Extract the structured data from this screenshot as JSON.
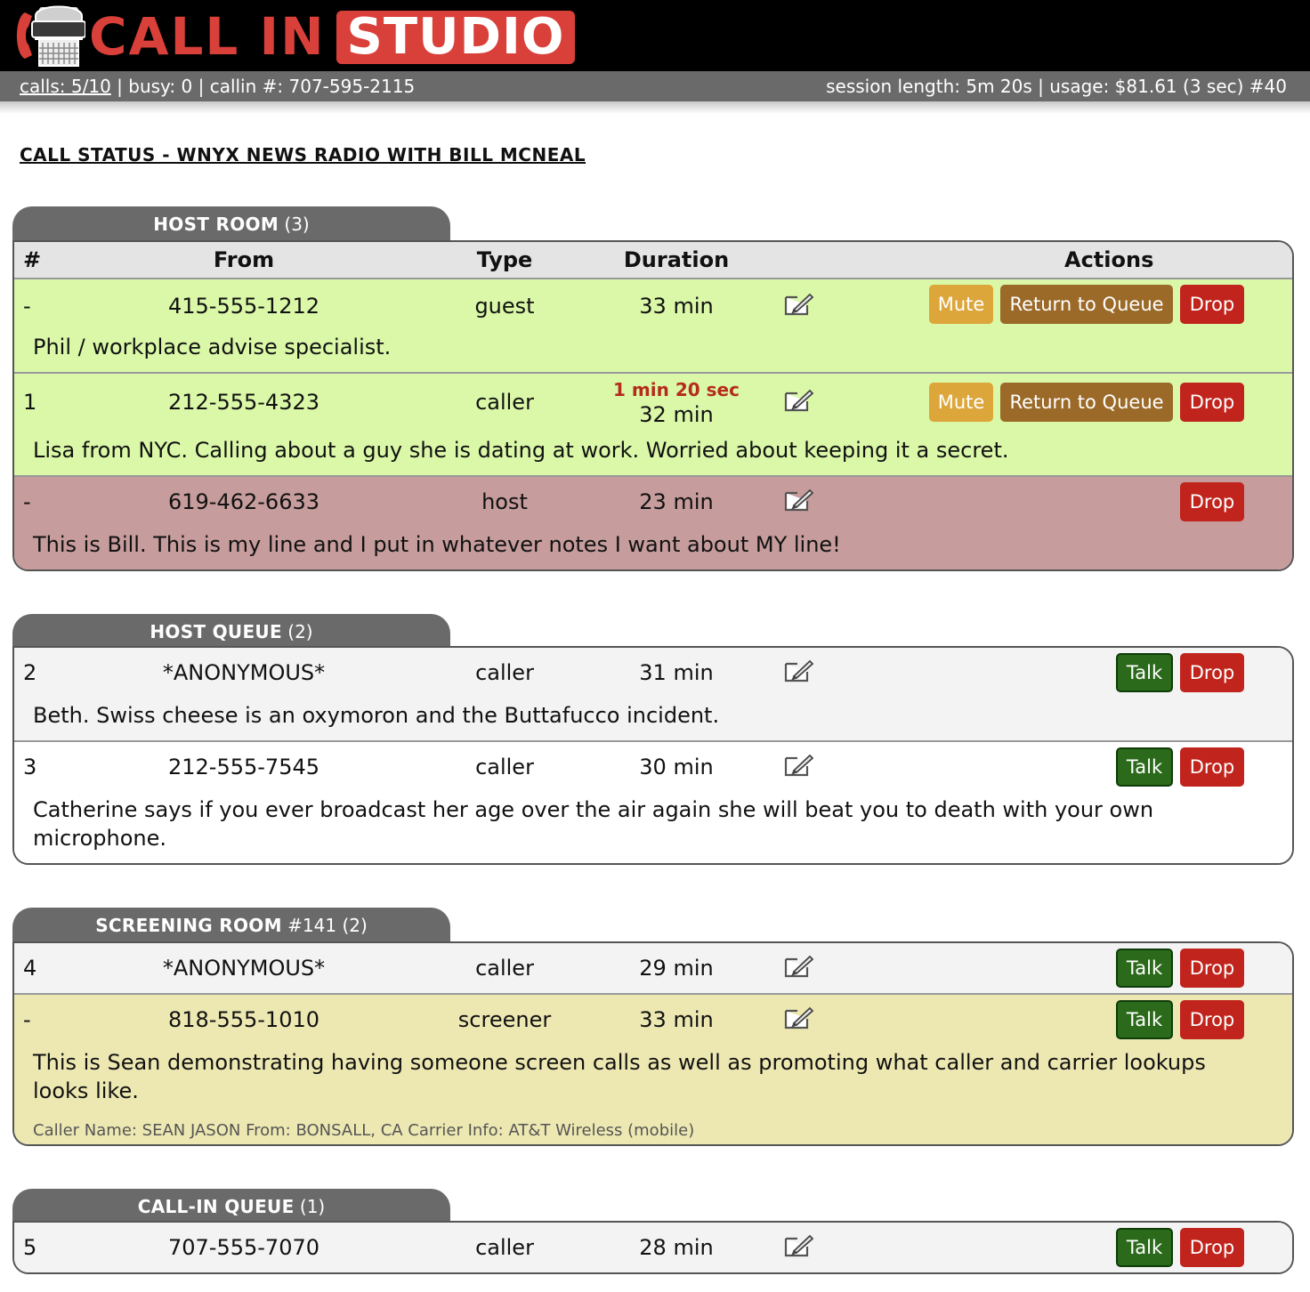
{
  "app": {
    "logo_call": "CALL IN",
    "logo_studio": "STUDIO"
  },
  "status": {
    "calls": "calls: 5/10",
    "rest_left": " | busy: 0 | callin #: 707-595-2115",
    "right": "session length: 5m 20s | usage: $81.61 (3 sec) #40"
  },
  "page_title": "CALL STATUS - WNYX NEWS RADIO WITH BILL MCNEAL",
  "columns": {
    "num": "#",
    "from": "From",
    "type": "Type",
    "duration": "Duration",
    "actions": "Actions"
  },
  "buttons": {
    "mute": "Mute",
    "return": "Return to Queue",
    "drop": "Drop",
    "talk": "Talk"
  },
  "host_room": {
    "title": "HOST ROOM",
    "count": "(3)",
    "rows": [
      {
        "num": "-",
        "from": "415-555-1212",
        "type": "guest",
        "duration": "33 min",
        "notes": "Phil / workplace advise specialist."
      },
      {
        "num": "1",
        "from": "212-555-4323",
        "type": "caller",
        "on_air": "1 min 20 sec",
        "duration": "32 min",
        "notes": "Lisa from NYC. Calling about a guy she is dating at work. Worried about keeping it a secret."
      },
      {
        "num": "-",
        "from": "619-462-6633",
        "type": "host",
        "duration": "23 min",
        "notes": "This is Bill. This is my line and I put in whatever notes I want about MY line!"
      }
    ]
  },
  "host_queue": {
    "title": "HOST QUEUE",
    "count": "(2)",
    "rows": [
      {
        "num": "2",
        "from": "*ANONYMOUS*",
        "type": "caller",
        "duration": "31 min",
        "notes": "Beth. Swiss cheese is an oxymoron and the Buttafucco incident."
      },
      {
        "num": "3",
        "from": "212-555-7545",
        "type": "caller",
        "duration": "30 min",
        "notes": "Catherine says if you ever broadcast her age over the air again she will beat you to death with your own microphone."
      }
    ]
  },
  "screening_room": {
    "title": "SCREENING ROOM",
    "suffix": "#141 (2)",
    "rows": [
      {
        "num": "4",
        "from": "*ANONYMOUS*",
        "type": "caller",
        "duration": "29 min"
      },
      {
        "num": "-",
        "from": "818-555-1010",
        "type": "screener",
        "duration": "33 min",
        "notes": "This is Sean demonstrating having someone screen calls as well as promoting what caller and carrier lookups looks like.",
        "lookup": "Caller Name: SEAN JASON From: BONSALL, CA Carrier Info: AT&T Wireless (mobile)"
      }
    ]
  },
  "callin_queue": {
    "title": "CALL-IN QUEUE",
    "count": "(1)",
    "rows": [
      {
        "num": "5",
        "from": "707-555-7070",
        "type": "caller",
        "duration": "28 min"
      }
    ]
  },
  "colors": {
    "logo_red": "#d9403a",
    "row_on_air": "#daf8a8",
    "row_host": "#c69c9c",
    "row_screener": "#ede8b2",
    "mute": "#dda63b",
    "return": "#9b6a28",
    "drop": "#c0241c",
    "talk": "#2b6a1a"
  },
  "icons": {
    "logo": "microphone-phone-logo-icon",
    "edit": "edit-note-icon"
  }
}
